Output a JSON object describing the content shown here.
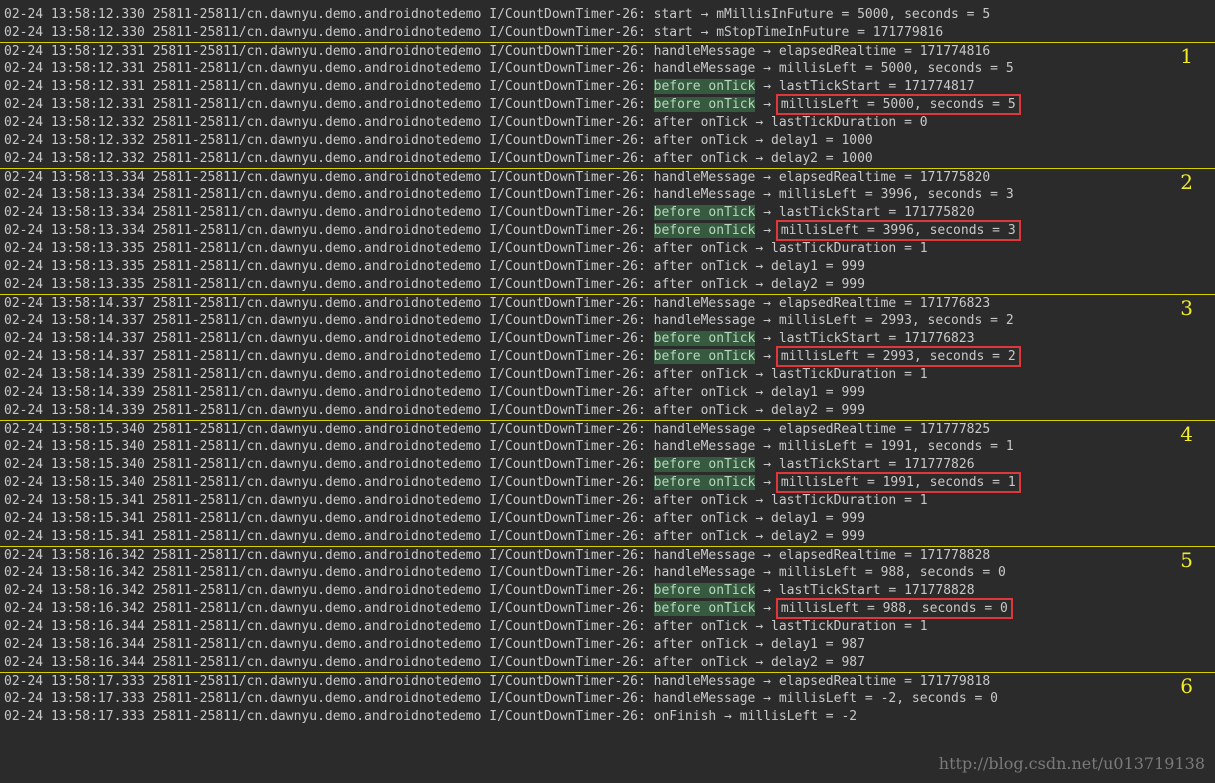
{
  "theme": {
    "background": "#2b2b2b",
    "text": "#c8c8c8",
    "separator": "#d8d000",
    "highlight": "#355a3f",
    "box": "#e0383a",
    "group_number": "#f0ec2a"
  },
  "log_rows": [
    {
      "text": "02-24 13:58:12.330 25811-25811/cn.dawnyu.demo.androidnotedemo I/CountDownTimer-26: start → mMillisInFuture = 5000, seconds = 5"
    },
    {
      "text": "02-24 13:58:12.330 25811-25811/cn.dawnyu.demo.androidnotedemo I/CountDownTimer-26: start → mStopTimeInFuture = 171779816"
    },
    {
      "text": "02-24 13:58:12.331 25811-25811/cn.dawnyu.demo.androidnotedemo I/CountDownTimer-26: handleMessage → elapsedRealtime = 171774816",
      "sep": true,
      "group": "1"
    },
    {
      "text": "02-24 13:58:12.331 25811-25811/cn.dawnyu.demo.androidnotedemo I/CountDownTimer-26: handleMessage → millisLeft = 5000, seconds = 5"
    },
    {
      "prefix": "02-24 13:58:12.331 25811-25811/cn.dawnyu.demo.androidnotedemo I/CountDownTimer-26: ",
      "hl": "before onTick",
      "rest": " → lastTickStart = 171774817"
    },
    {
      "prefix": "02-24 13:58:12.331 25811-25811/cn.dawnyu.demo.androidnotedemo I/CountDownTimer-26: ",
      "hl": "before onTick",
      "arrow": " → ",
      "boxed": "millisLeft = 5000, seconds = 5"
    },
    {
      "text": "02-24 13:58:12.332 25811-25811/cn.dawnyu.demo.androidnotedemo I/CountDownTimer-26: after onTick → lastTickDuration = 0"
    },
    {
      "text": "02-24 13:58:12.332 25811-25811/cn.dawnyu.demo.androidnotedemo I/CountDownTimer-26: after onTick → delay1 = 1000"
    },
    {
      "text": "02-24 13:58:12.332 25811-25811/cn.dawnyu.demo.androidnotedemo I/CountDownTimer-26: after onTick → delay2 = 1000"
    },
    {
      "text": "02-24 13:58:13.334 25811-25811/cn.dawnyu.demo.androidnotedemo I/CountDownTimer-26: handleMessage → elapsedRealtime = 171775820",
      "sep": true,
      "group": "2"
    },
    {
      "text": "02-24 13:58:13.334 25811-25811/cn.dawnyu.demo.androidnotedemo I/CountDownTimer-26: handleMessage → millisLeft = 3996, seconds = 3"
    },
    {
      "prefix": "02-24 13:58:13.334 25811-25811/cn.dawnyu.demo.androidnotedemo I/CountDownTimer-26: ",
      "hl": "before onTick",
      "rest": " → lastTickStart = 171775820"
    },
    {
      "prefix": "02-24 13:58:13.334 25811-25811/cn.dawnyu.demo.androidnotedemo I/CountDownTimer-26: ",
      "hl": "before onTick",
      "arrow": " → ",
      "boxed": "millisLeft = 3996, seconds = 3"
    },
    {
      "text": "02-24 13:58:13.335 25811-25811/cn.dawnyu.demo.androidnotedemo I/CountDownTimer-26: after onTick → lastTickDuration = 1"
    },
    {
      "text": "02-24 13:58:13.335 25811-25811/cn.dawnyu.demo.androidnotedemo I/CountDownTimer-26: after onTick → delay1 = 999"
    },
    {
      "text": "02-24 13:58:13.335 25811-25811/cn.dawnyu.demo.androidnotedemo I/CountDownTimer-26: after onTick → delay2 = 999"
    },
    {
      "text": "02-24 13:58:14.337 25811-25811/cn.dawnyu.demo.androidnotedemo I/CountDownTimer-26: handleMessage → elapsedRealtime = 171776823",
      "sep": true,
      "group": "3"
    },
    {
      "text": "02-24 13:58:14.337 25811-25811/cn.dawnyu.demo.androidnotedemo I/CountDownTimer-26: handleMessage → millisLeft = 2993, seconds = 2"
    },
    {
      "prefix": "02-24 13:58:14.337 25811-25811/cn.dawnyu.demo.androidnotedemo I/CountDownTimer-26: ",
      "hl": "before onTick",
      "rest": " → lastTickStart = 171776823"
    },
    {
      "prefix": "02-24 13:58:14.337 25811-25811/cn.dawnyu.demo.androidnotedemo I/CountDownTimer-26: ",
      "hl": "before onTick",
      "arrow": " → ",
      "boxed": "millisLeft = 2993, seconds = 2"
    },
    {
      "text": "02-24 13:58:14.339 25811-25811/cn.dawnyu.demo.androidnotedemo I/CountDownTimer-26: after onTick → lastTickDuration = 1"
    },
    {
      "text": "02-24 13:58:14.339 25811-25811/cn.dawnyu.demo.androidnotedemo I/CountDownTimer-26: after onTick → delay1 = 999"
    },
    {
      "text": "02-24 13:58:14.339 25811-25811/cn.dawnyu.demo.androidnotedemo I/CountDownTimer-26: after onTick → delay2 = 999"
    },
    {
      "text": "02-24 13:58:15.340 25811-25811/cn.dawnyu.demo.androidnotedemo I/CountDownTimer-26: handleMessage → elapsedRealtime = 171777825",
      "sep": true,
      "group": "4"
    },
    {
      "text": "02-24 13:58:15.340 25811-25811/cn.dawnyu.demo.androidnotedemo I/CountDownTimer-26: handleMessage → millisLeft = 1991, seconds = 1"
    },
    {
      "prefix": "02-24 13:58:15.340 25811-25811/cn.dawnyu.demo.androidnotedemo I/CountDownTimer-26: ",
      "hl": "before onTick",
      "rest": " → lastTickStart = 171777826"
    },
    {
      "prefix": "02-24 13:58:15.340 25811-25811/cn.dawnyu.demo.androidnotedemo I/CountDownTimer-26: ",
      "hl": "before onTick",
      "arrow": " → ",
      "boxed": "millisLeft = 1991, seconds = 1"
    },
    {
      "text": "02-24 13:58:15.341 25811-25811/cn.dawnyu.demo.androidnotedemo I/CountDownTimer-26: after onTick → lastTickDuration = 1"
    },
    {
      "text": "02-24 13:58:15.341 25811-25811/cn.dawnyu.demo.androidnotedemo I/CountDownTimer-26: after onTick → delay1 = 999"
    },
    {
      "text": "02-24 13:58:15.341 25811-25811/cn.dawnyu.demo.androidnotedemo I/CountDownTimer-26: after onTick → delay2 = 999"
    },
    {
      "text": "02-24 13:58:16.342 25811-25811/cn.dawnyu.demo.androidnotedemo I/CountDownTimer-26: handleMessage → elapsedRealtime = 171778828",
      "sep": true,
      "group": "5"
    },
    {
      "text": "02-24 13:58:16.342 25811-25811/cn.dawnyu.demo.androidnotedemo I/CountDownTimer-26: handleMessage → millisLeft = 988, seconds = 0"
    },
    {
      "prefix": "02-24 13:58:16.342 25811-25811/cn.dawnyu.demo.androidnotedemo I/CountDownTimer-26: ",
      "hl": "before onTick",
      "rest": " → lastTickStart = 171778828"
    },
    {
      "prefix": "02-24 13:58:16.342 25811-25811/cn.dawnyu.demo.androidnotedemo I/CountDownTimer-26: ",
      "hl": "before onTick",
      "arrow": " → ",
      "boxed": "millisLeft = 988, seconds = 0"
    },
    {
      "text": "02-24 13:58:16.344 25811-25811/cn.dawnyu.demo.androidnotedemo I/CountDownTimer-26: after onTick → lastTickDuration = 1"
    },
    {
      "text": "02-24 13:58:16.344 25811-25811/cn.dawnyu.demo.androidnotedemo I/CountDownTimer-26: after onTick → delay1 = 987"
    },
    {
      "text": "02-24 13:58:16.344 25811-25811/cn.dawnyu.demo.androidnotedemo I/CountDownTimer-26: after onTick → delay2 = 987"
    },
    {
      "text": "02-24 13:58:17.333 25811-25811/cn.dawnyu.demo.androidnotedemo I/CountDownTimer-26: handleMessage → elapsedRealtime = 171779818",
      "sep": true,
      "group": "6"
    },
    {
      "text": "02-24 13:58:17.333 25811-25811/cn.dawnyu.demo.androidnotedemo I/CountDownTimer-26: handleMessage → millisLeft = -2, seconds = 0"
    },
    {
      "text": "02-24 13:58:17.333 25811-25811/cn.dawnyu.demo.androidnotedemo I/CountDownTimer-26: onFinish → millisLeft = -2"
    }
  ],
  "watermark": "http://blog.csdn.net/u013719138"
}
